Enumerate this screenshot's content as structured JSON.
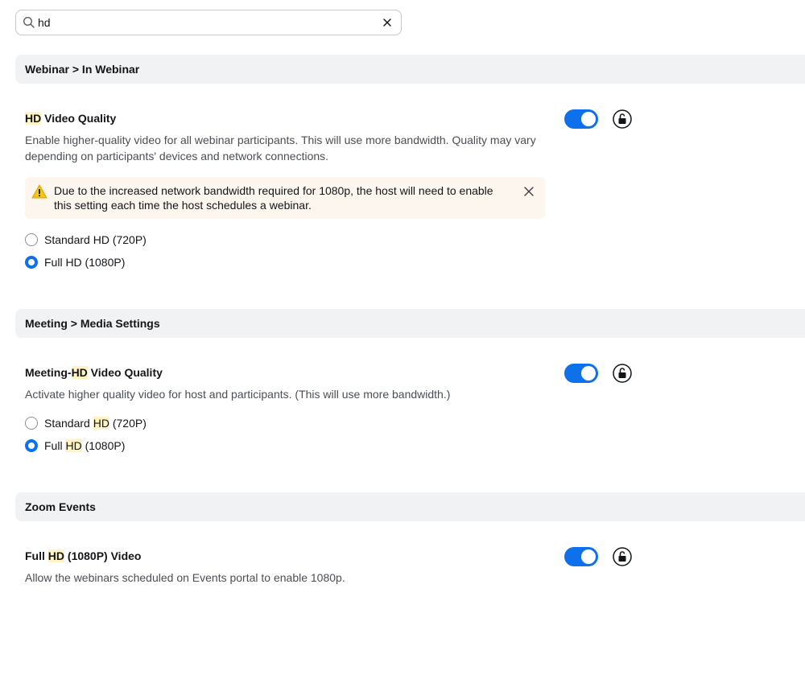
{
  "search": {
    "value": "hd",
    "placeholder": ""
  },
  "sections": [
    {
      "header": "Webinar > In Webinar",
      "setting": {
        "title_hl": "HD",
        "title_rest": " Video Quality",
        "description": "Enable higher-quality video for all webinar participants. This will use more bandwidth. Quality may vary depending on participants' devices and network connections.",
        "enabled": true,
        "warning": "Due to the increased network bandwidth required for 1080p, the host will need to enable this setting each time the host schedules a webinar.",
        "options": [
          {
            "label": "Standard HD (720P)",
            "selected": false
          },
          {
            "label": "Full HD (1080P)",
            "selected": true
          }
        ]
      }
    },
    {
      "header": "Meeting > Media Settings",
      "setting": {
        "title_pre": "Meeting-",
        "title_hl": "HD",
        "title_rest": " Video Quality",
        "description": "Activate higher quality video for host and participants. (This will use more bandwidth.)",
        "enabled": true,
        "options": [
          {
            "pre": "Standard ",
            "hl": "HD",
            "post": " (720P)",
            "selected": false
          },
          {
            "pre": "Full ",
            "hl": "HD",
            "post": " (1080P)",
            "selected": true
          }
        ]
      }
    },
    {
      "header": "Zoom Events",
      "setting": {
        "title_pre": "Full ",
        "title_hl": "HD",
        "title_rest": " (1080P) Video",
        "description": "Allow the webinars scheduled on Events portal to enable 1080p.",
        "enabled": true
      }
    }
  ],
  "colors": {
    "accent": "#0e71eb",
    "highlight": "#fff3c4",
    "warning_bg": "#fdf6ef",
    "warning_icon": "#f5c518",
    "header_bg": "#f1f2f4"
  }
}
